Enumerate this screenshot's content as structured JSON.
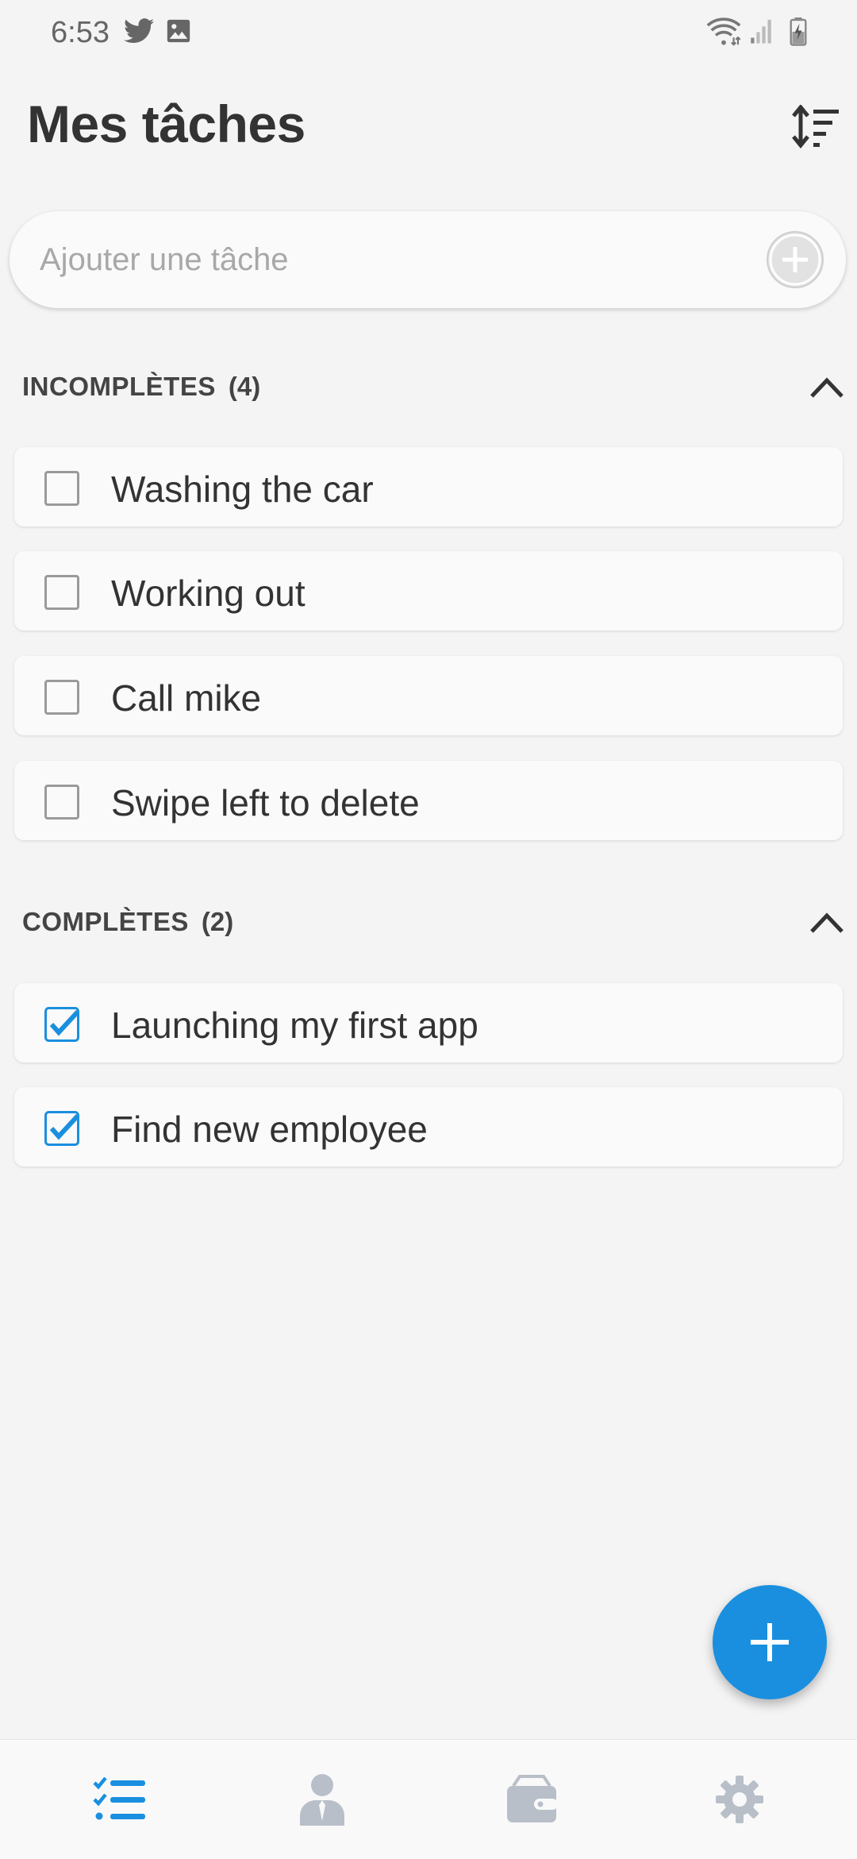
{
  "status_bar": {
    "time": "6:53",
    "left_icons": [
      "twitter-icon",
      "image-icon"
    ],
    "right_icons": [
      "wifi-icon",
      "signal-icon",
      "battery-charging-icon"
    ]
  },
  "header": {
    "title": "Mes tâches",
    "sort_icon": "sort-icon"
  },
  "add_task": {
    "placeholder": "Ajouter une tâche",
    "value": "",
    "button_icon": "add-circle-icon"
  },
  "sections": {
    "incomplete": {
      "title": "INCOMPLÈTES",
      "count": "(4)",
      "expanded": true,
      "tasks": [
        {
          "label": "Washing the car",
          "checked": false
        },
        {
          "label": "Working out",
          "checked": false
        },
        {
          "label": "Call mike",
          "checked": false
        },
        {
          "label": "Swipe left to delete",
          "checked": false
        }
      ]
    },
    "complete": {
      "title": "COMPLÈTES",
      "count": "(2)",
      "expanded": true,
      "tasks": [
        {
          "label": "Launching my first app",
          "checked": true
        },
        {
          "label": "Find new employee",
          "checked": true
        }
      ]
    }
  },
  "fab": {
    "icon": "plus-icon"
  },
  "bottom_nav": {
    "items": [
      {
        "icon": "checklist-icon",
        "active": true
      },
      {
        "icon": "person-icon",
        "active": false
      },
      {
        "icon": "wallet-icon",
        "active": false
      },
      {
        "icon": "gear-icon",
        "active": false
      }
    ]
  },
  "colors": {
    "accent": "#1a8fdf",
    "background": "#f4f4f4",
    "card": "#fafafa",
    "text": "#333333",
    "nav_inactive": "#b8bfc8"
  }
}
